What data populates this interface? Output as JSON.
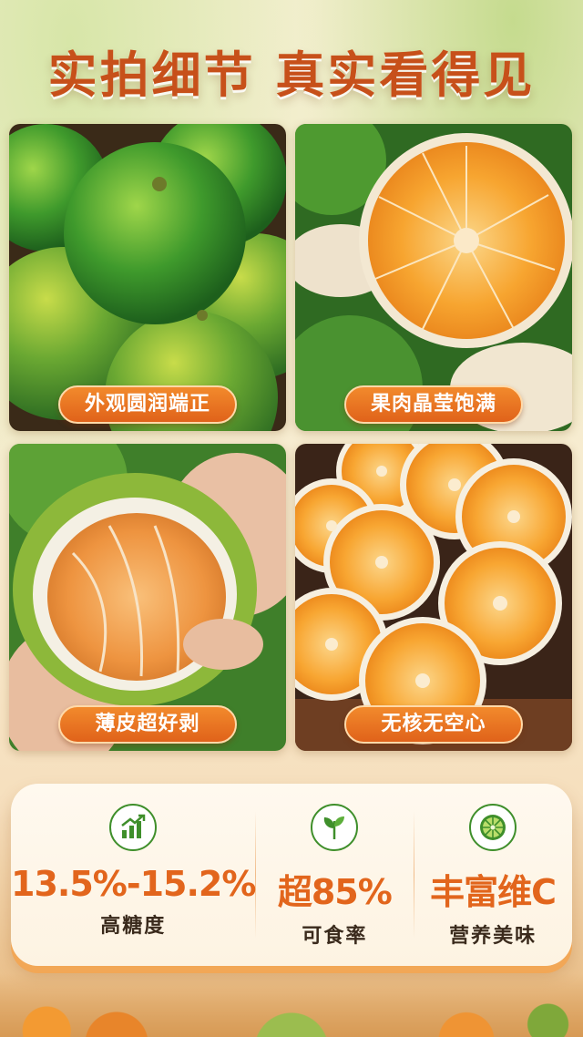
{
  "header": {
    "title": "实拍细节 真实看得见"
  },
  "photos": [
    {
      "caption": "外观圆润端正"
    },
    {
      "caption": "果肉晶莹饱满"
    },
    {
      "caption": "薄皮超好剥"
    },
    {
      "caption": "无核无空心"
    }
  ],
  "stats": [
    {
      "icon": "chart-up-icon",
      "value": "13.5%-15.2%",
      "label": "高糖度"
    },
    {
      "icon": "leaf-icon",
      "value": "超85%",
      "label": "可食率"
    },
    {
      "icon": "citrus-slice-icon",
      "value": "丰富维C",
      "label": "营养美味"
    }
  ],
  "colors": {
    "accent": "#e2651c",
    "title": "#c7501a",
    "icon": "#3f8f2b"
  }
}
